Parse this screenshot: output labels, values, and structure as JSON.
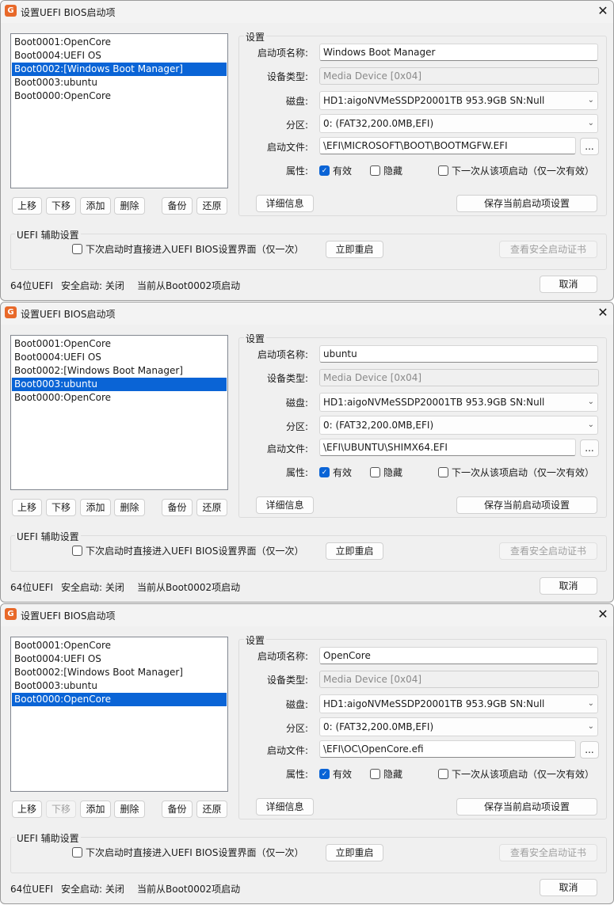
{
  "windows": [
    {
      "title": "设置UEFI BIOS启动项",
      "boot_entries": [
        {
          "label": "Boot0001:OpenCore",
          "selected": false
        },
        {
          "label": "Boot0004:UEFI OS",
          "selected": false
        },
        {
          "label": "Boot0002:[Windows Boot Manager]",
          "selected": true
        },
        {
          "label": "Boot0003:ubuntu",
          "selected": false
        },
        {
          "label": "Boot0000:OpenCore",
          "selected": false
        }
      ],
      "move_down_enabled": true,
      "settings": {
        "entry_name": "Windows Boot Manager",
        "device_type": "Media Device [0x04]",
        "disk": "HD1:aigoNVMeSSDP20001TB 953.9GB SN:Null",
        "partition": "0: (FAT32,200.0MB,EFI)",
        "boot_file": "\\EFI\\MICROSOFT\\BOOT\\BOOTMGFW.EFI"
      }
    },
    {
      "title": "设置UEFI BIOS启动项",
      "boot_entries": [
        {
          "label": "Boot0001:OpenCore",
          "selected": false
        },
        {
          "label": "Boot0004:UEFI OS",
          "selected": false
        },
        {
          "label": "Boot0002:[Windows Boot Manager]",
          "selected": false
        },
        {
          "label": "Boot0003:ubuntu",
          "selected": true
        },
        {
          "label": "Boot0000:OpenCore",
          "selected": false
        }
      ],
      "move_down_enabled": true,
      "settings": {
        "entry_name": "ubuntu",
        "device_type": "Media Device [0x04]",
        "disk": "HD1:aigoNVMeSSDP20001TB 953.9GB SN:Null",
        "partition": "0: (FAT32,200.0MB,EFI)",
        "boot_file": "\\EFI\\UBUNTU\\SHIMX64.EFI"
      }
    },
    {
      "title": "设置UEFI BIOS启动项",
      "boot_entries": [
        {
          "label": "Boot0001:OpenCore",
          "selected": false
        },
        {
          "label": "Boot0004:UEFI OS",
          "selected": false
        },
        {
          "label": "Boot0002:[Windows Boot Manager]",
          "selected": false
        },
        {
          "label": "Boot0003:ubuntu",
          "selected": false
        },
        {
          "label": "Boot0000:OpenCore",
          "selected": true
        }
      ],
      "move_down_enabled": false,
      "settings": {
        "entry_name": "OpenCore",
        "device_type": "Media Device [0x04]",
        "disk": "HD1:aigoNVMeSSDP20001TB 953.9GB SN:Null",
        "partition": "0: (FAT32,200.0MB,EFI)",
        "boot_file": "\\EFI\\OC\\OpenCore.efi"
      }
    }
  ],
  "labels": {
    "move_up": "上移",
    "move_down": "下移",
    "add": "添加",
    "delete": "删除",
    "backup": "备份",
    "restore": "还原",
    "settings_group": "设置",
    "entry_name": "启动项名称:",
    "device_type": "设备类型:",
    "disk": "磁盘:",
    "partition": "分区:",
    "boot_file": "启动文件:",
    "browse": "...",
    "attributes": "属性:",
    "active": "有效",
    "hidden": "隐藏",
    "boot_next": "下一次从该项启动（仅一次有效）",
    "details": "详细信息",
    "save": "保存当前启动项设置",
    "uefi_group": "UEFI 辅助设置",
    "enter_bios": "下次启动时直接进入UEFI BIOS设置界面（仅一次）",
    "restart_now": "立即重启",
    "view_certs": "查看安全启动证书",
    "status_uefi": "64位UEFI",
    "status_secure_boot": "安全启动: 关闭",
    "status_current": "当前从Boot0002项启动",
    "cancel": "取消",
    "close": "✕",
    "check": "✓"
  },
  "attributes_state": {
    "active": true,
    "hidden": false,
    "boot_next": false,
    "enter_bios": false
  },
  "colors": {
    "accent": "#0a64d6",
    "app_icon": "#e8692a"
  }
}
